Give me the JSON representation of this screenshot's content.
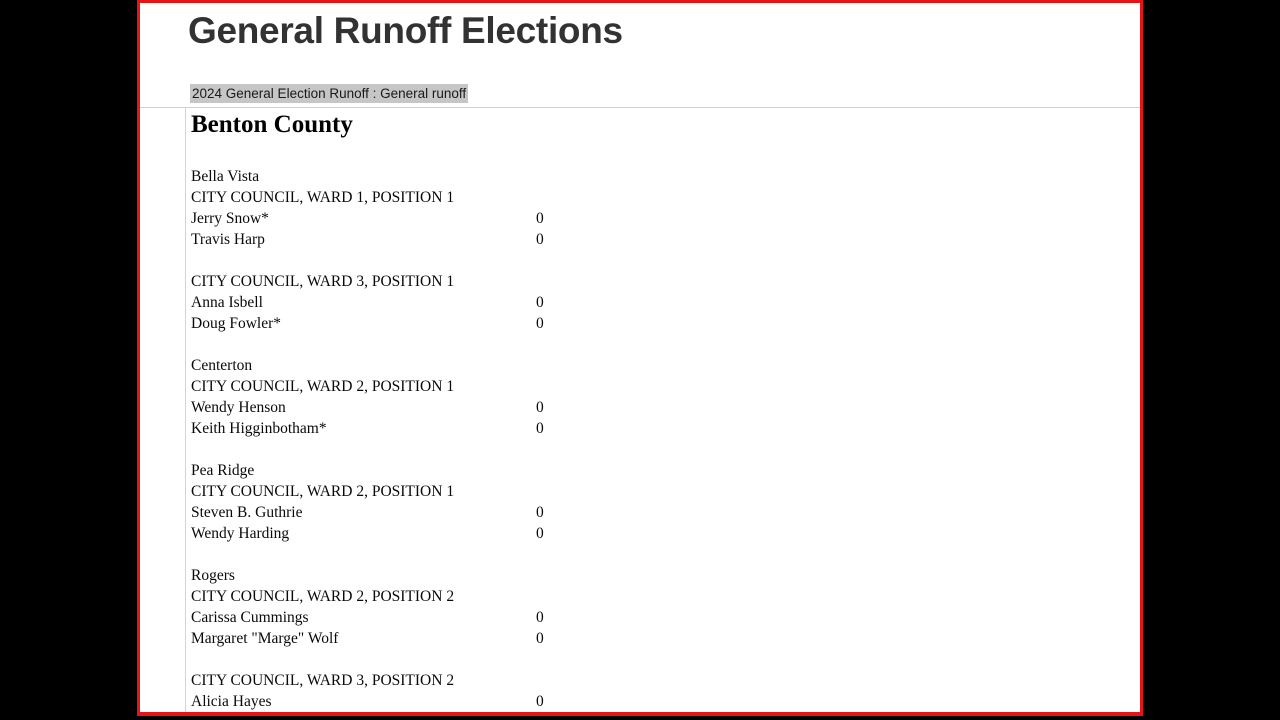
{
  "page": {
    "title": "General Runoff Elections",
    "breadcrumb": "2024 General Election Runoff : General runoff",
    "county_heading": "Benton County",
    "frame_color": "#e71316",
    "title_color": "#323232",
    "breadcrumb_highlight_color": "#c6c6c6"
  },
  "results": {
    "cities": [
      {
        "name": "Bella Vista",
        "contests": [
          {
            "office": "CITY COUNCIL, WARD 1, POSITION 1",
            "candidates": [
              {
                "name": "Jerry Snow*",
                "votes": "0"
              },
              {
                "name": "Travis Harp",
                "votes": "0"
              }
            ]
          },
          {
            "office": "CITY COUNCIL, WARD 3, POSITION 1",
            "candidates": [
              {
                "name": "Anna Isbell",
                "votes": "0"
              },
              {
                "name": "Doug Fowler*",
                "votes": "0"
              }
            ]
          }
        ]
      },
      {
        "name": "Centerton",
        "contests": [
          {
            "office": "CITY COUNCIL, WARD 2, POSITION 1",
            "candidates": [
              {
                "name": "Wendy Henson",
                "votes": "0"
              },
              {
                "name": "Keith Higginbotham*",
                "votes": "0"
              }
            ]
          }
        ]
      },
      {
        "name": "Pea Ridge",
        "contests": [
          {
            "office": "CITY COUNCIL, WARD 2, POSITION 1",
            "candidates": [
              {
                "name": "Steven B. Guthrie",
                "votes": "0"
              },
              {
                "name": "Wendy Harding",
                "votes": "0"
              }
            ]
          }
        ]
      },
      {
        "name": "Rogers",
        "contests": [
          {
            "office": "CITY COUNCIL, WARD 2, POSITION 2",
            "candidates": [
              {
                "name": "Carissa Cummings",
                "votes": "0"
              },
              {
                "name": "Margaret \"Marge\" Wolf",
                "votes": "0"
              }
            ]
          },
          {
            "office": "CITY COUNCIL, WARD 3, POSITION 2",
            "candidates": [
              {
                "name": "Alicia Hayes",
                "votes": "0"
              }
            ]
          }
        ]
      }
    ]
  }
}
